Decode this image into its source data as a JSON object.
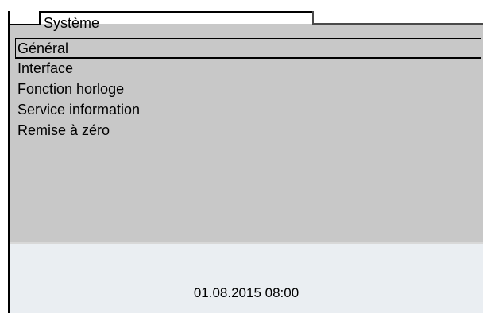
{
  "header": {
    "tab_title": "Système"
  },
  "menu": {
    "items": [
      {
        "label": "Général",
        "selected": true
      },
      {
        "label": "Interface",
        "selected": false
      },
      {
        "label": "Fonction horloge",
        "selected": false
      },
      {
        "label": "Service information",
        "selected": false
      },
      {
        "label": "Remise à zéro",
        "selected": false
      }
    ]
  },
  "status": {
    "datetime": "01.08.2015 08:00"
  },
  "colors": {
    "panel_background": "#c8c8c8",
    "status_background": "#eaeef2",
    "text": "#000000"
  }
}
